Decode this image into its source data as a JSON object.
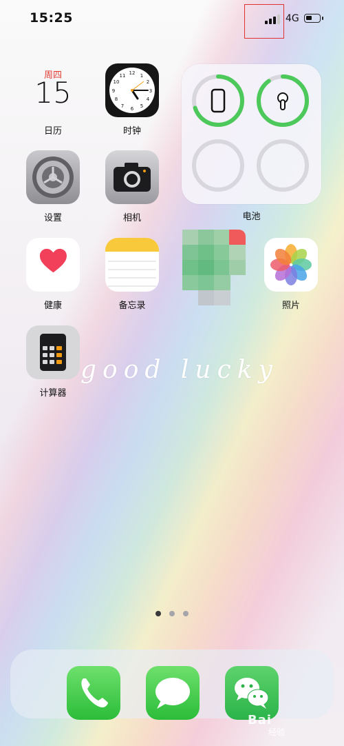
{
  "status_bar": {
    "time": "15:25",
    "network": "4G",
    "signal_bars_filled": 3,
    "signal_bars_total": 4,
    "battery_level": 0.35
  },
  "apps": {
    "calendar": {
      "weekday": "周四",
      "date": "15",
      "label": "日历",
      "icon": "calendar-icon"
    },
    "clock": {
      "label": "时钟",
      "icon": "clock-icon"
    },
    "settings": {
      "label": "设置",
      "icon": "gear-icon"
    },
    "camera": {
      "label": "相机",
      "icon": "camera-icon"
    },
    "health": {
      "label": "健康",
      "icon": "heart-icon"
    },
    "notes": {
      "label": "备忘录",
      "icon": "notes-icon"
    },
    "photos": {
      "label": "照片",
      "icon": "photos-icon"
    },
    "calculator": {
      "label": "计算器",
      "icon": "calculator-icon"
    }
  },
  "battery_widget": {
    "label": "电池",
    "devices": [
      {
        "icon": "iphone-icon",
        "level": 0.7
      },
      {
        "icon": "airpods-icon",
        "level": 0.9
      },
      {
        "icon": "empty-slot",
        "level": 0
      },
      {
        "icon": "empty-slot",
        "level": 0
      }
    ]
  },
  "wallpaper_text": "good lucky",
  "page_dots": {
    "count": 3,
    "active": 0
  },
  "dock": [
    {
      "app": "phone",
      "icon": "phone-icon"
    },
    {
      "app": "messages",
      "icon": "message-bubble-icon"
    },
    {
      "app": "wechat",
      "icon": "wechat-icon"
    }
  ],
  "watermark": {
    "text": "Bai",
    "sub": "经验"
  },
  "colors": {
    "ring_green": "#4cc95a",
    "ring_track": "#d9d7de",
    "selection_box": "#e03030"
  }
}
